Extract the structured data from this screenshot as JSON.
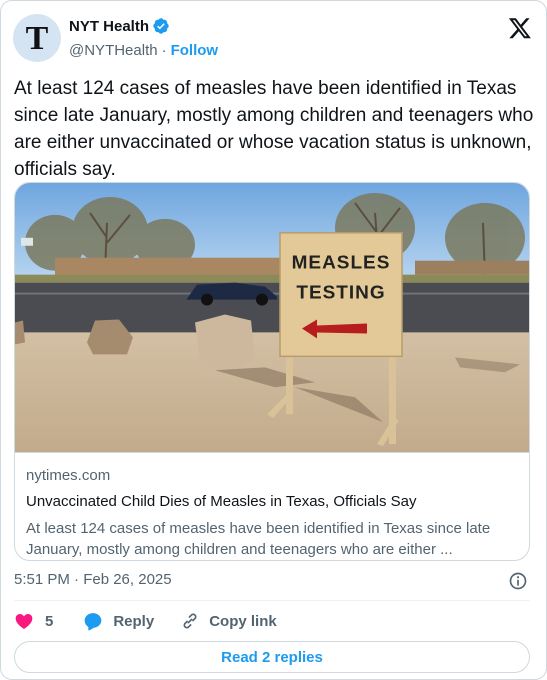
{
  "author": {
    "display_name": "NYT Health",
    "handle": "@NYTHealth",
    "separator": "·",
    "follow_label": "Follow",
    "avatar_letter": "T"
  },
  "tweet": {
    "text": "At least 124 cases of measles have been identified in Texas since late January, mostly among children and teenagers who are either unvaccinated or whose vacation status is unknown, officials say."
  },
  "link_card": {
    "photo_sign_line1": "MEASLES",
    "photo_sign_line2": "TESTING",
    "domain": "nytimes.com",
    "title": "Unvaccinated Child Dies of Measles in Texas, Officials Say",
    "description": "At least 124 cases of measles have been identified in Texas since late January, mostly among children and teenagers who are either ..."
  },
  "meta": {
    "timestamp": "5:51 PM · Feb 26, 2025"
  },
  "actions": {
    "like_count": "5",
    "reply_label": "Reply",
    "copy_label": "Copy link"
  },
  "footer": {
    "read_replies_label": "Read 2 replies"
  },
  "colors": {
    "accent": "#1d9bf0",
    "like": "#f91880",
    "muted_text": "#536471",
    "border": "#cfd9de"
  }
}
